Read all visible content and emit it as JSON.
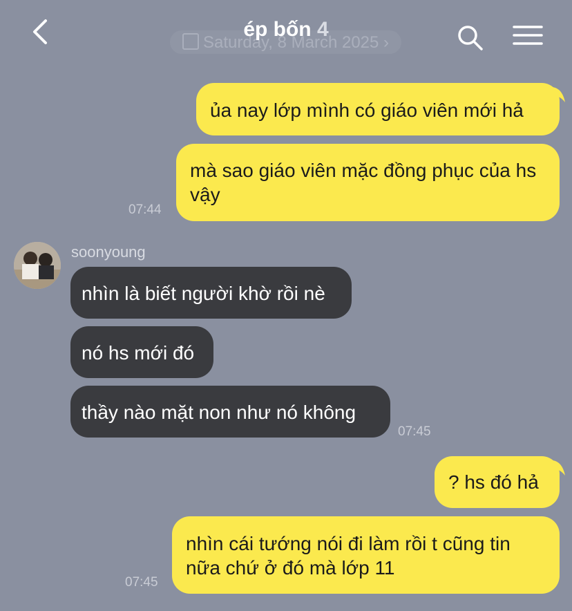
{
  "header": {
    "title": "ép bốn",
    "member_count": "4",
    "date": "Saturday, 8 March 2025"
  },
  "messages": [
    {
      "side": "me",
      "text": "ủa nay lớp mình có giáo viên mới hả"
    },
    {
      "side": "me",
      "text": "mà sao giáo viên mặc đồng phục của hs vậy",
      "time": "07:44"
    },
    {
      "side": "them",
      "sender": "soonyoung",
      "text": "nhìn là biết người khờ rồi nè"
    },
    {
      "side": "them",
      "text": "nó hs mới đó"
    },
    {
      "side": "them",
      "text": "thầy nào mặt non như nó không",
      "time": "07:45"
    },
    {
      "side": "me",
      "text": "? hs đó hả"
    },
    {
      "side": "me",
      "text": "nhìn cái tướng nói đi làm rồi t cũng tin nữa chứ ở đó mà lớp 11",
      "time": "07:45"
    }
  ],
  "icons": {
    "back": "chevron-left-icon",
    "search": "search-icon",
    "menu": "hamburger-menu-icon",
    "date": "calendar-icon"
  },
  "colors": {
    "background": "#8a90a0",
    "my_bubble": "#fbe94e",
    "their_bubble": "#3a3b3f"
  }
}
